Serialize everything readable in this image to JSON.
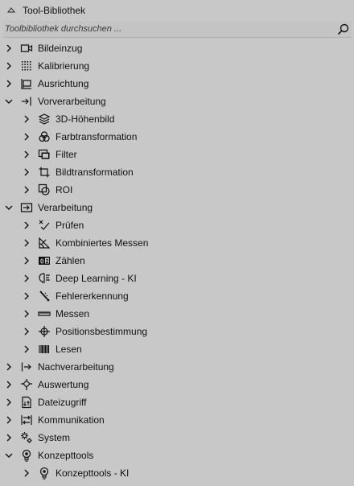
{
  "header": {
    "title": "Tool-Bibliothek"
  },
  "search": {
    "placeholder": "Toolbibliothek durchsuchen ..."
  },
  "tree": [
    {
      "label": "Bildeinzug",
      "level": 0,
      "expanded": false,
      "icon": "camera-icon"
    },
    {
      "label": "Kalibrierung",
      "level": 0,
      "expanded": false,
      "icon": "grid-dots-icon"
    },
    {
      "label": "Ausrichtung",
      "level": 0,
      "expanded": false,
      "icon": "align-icon"
    },
    {
      "label": "Vorverarbeitung",
      "level": 0,
      "expanded": true,
      "icon": "arrow-into-bar-icon"
    },
    {
      "label": "3D-Höhenbild",
      "level": 1,
      "expanded": false,
      "icon": "layers-icon"
    },
    {
      "label": "Farbtransformation",
      "level": 1,
      "expanded": false,
      "icon": "color-circles-icon"
    },
    {
      "label": "Filter",
      "level": 1,
      "expanded": false,
      "icon": "filter-window-icon"
    },
    {
      "label": "Bildtransformation",
      "level": 1,
      "expanded": false,
      "icon": "crop-icon"
    },
    {
      "label": "ROI",
      "level": 1,
      "expanded": false,
      "icon": "roi-icon"
    },
    {
      "label": "Verarbeitung",
      "level": 0,
      "expanded": true,
      "icon": "arrow-in-box-icon"
    },
    {
      "label": "Prüfen",
      "level": 1,
      "expanded": false,
      "icon": "check-cross-icon"
    },
    {
      "label": "Kombiniertes Messen",
      "level": 1,
      "expanded": false,
      "icon": "combined-measure-icon"
    },
    {
      "label": "Zählen",
      "level": 1,
      "expanded": false,
      "icon": "counter-icon"
    },
    {
      "label": "Deep Learning - KI",
      "level": 1,
      "expanded": false,
      "icon": "brain-icon"
    },
    {
      "label": "Fehlererkennung",
      "level": 1,
      "expanded": false,
      "icon": "defect-icon"
    },
    {
      "label": "Messen",
      "level": 1,
      "expanded": false,
      "icon": "ruler-icon"
    },
    {
      "label": "Positionsbestimmung",
      "level": 1,
      "expanded": false,
      "icon": "crosshair-icon"
    },
    {
      "label": "Lesen",
      "level": 1,
      "expanded": false,
      "icon": "barcode-icon"
    },
    {
      "label": "Nachverarbeitung",
      "level": 0,
      "expanded": false,
      "icon": "bar-arrow-out-icon"
    },
    {
      "label": "Auswertung",
      "level": 0,
      "expanded": false,
      "icon": "decision-icon"
    },
    {
      "label": "Dateizugriff",
      "level": 0,
      "expanded": false,
      "icon": "file-access-icon"
    },
    {
      "label": "Kommunikation",
      "level": 0,
      "expanded": false,
      "icon": "communication-icon"
    },
    {
      "label": "System",
      "level": 0,
      "expanded": false,
      "icon": "gears-icon"
    },
    {
      "label": "Konzepttools",
      "level": 0,
      "expanded": true,
      "icon": "lightbulb-icon"
    },
    {
      "label": "Konzepttools - KI",
      "level": 1,
      "expanded": false,
      "icon": "lightbulb-icon"
    }
  ]
}
